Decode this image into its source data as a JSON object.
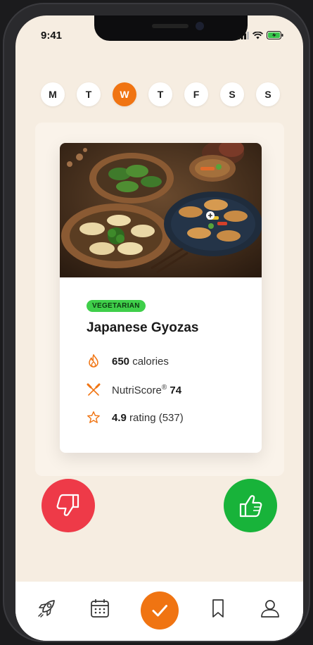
{
  "status": {
    "time": "9:41"
  },
  "days": [
    {
      "label": "M",
      "active": false
    },
    {
      "label": "T",
      "active": false
    },
    {
      "label": "W",
      "active": true
    },
    {
      "label": "T",
      "active": false
    },
    {
      "label": "F",
      "active": false
    },
    {
      "label": "S",
      "active": false
    },
    {
      "label": "S",
      "active": false
    }
  ],
  "recipe": {
    "tag": "VEGETARIAN",
    "title": "Japanese Gyozas",
    "calories_value": "650",
    "calories_label": "calories",
    "nutriscore_label": "NutriScore",
    "nutriscore_mark": "®",
    "nutriscore_value": "74",
    "rating_value": "4.9",
    "rating_label": "rating (537)"
  },
  "actions": {
    "dislike_icon": "thumbs-down-icon",
    "like_icon": "thumbs-up-icon"
  },
  "tabbar": {
    "items": [
      "rocket-icon",
      "calendar-icon",
      "check-icon",
      "bookmark-icon",
      "profile-icon"
    ]
  },
  "colors": {
    "accent": "#f07412",
    "background": "#f6ede1",
    "dislike": "#ee3a48",
    "like": "#18b33a",
    "tag": "#3fcf4a"
  }
}
